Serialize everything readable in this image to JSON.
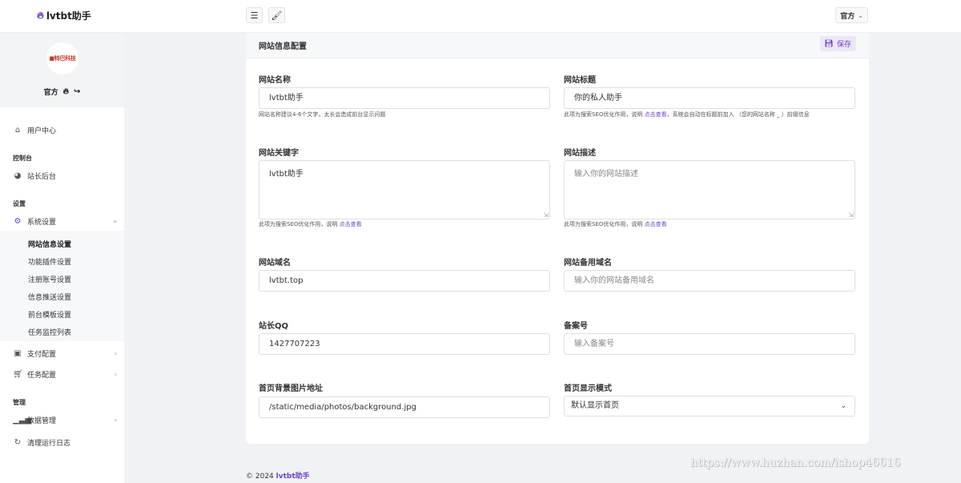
{
  "app": {
    "name": "lvtbt助手"
  },
  "topbar": {
    "menu_icon": "hamburger-icon",
    "theme_icon": "brush-icon",
    "user_label": "官方"
  },
  "sidebar": {
    "profile": {
      "avatar_text": "■特巴科技",
      "name": "官方"
    },
    "user_center": "用户中心",
    "section_console": "控制台",
    "admin_backend": "站长后台",
    "section_settings": "设置",
    "system_settings": "系统设置",
    "sub_items": [
      "网站信息设置",
      "功能插件设置",
      "注册账号设置",
      "信息推送设置",
      "前台模板设置",
      "任务监控列表"
    ],
    "payment_config": "支付配置",
    "task_config": "任务配置",
    "section_manage": "管理",
    "data_manage": "数据管理",
    "clear_logs": "清理运行日志"
  },
  "card": {
    "title": "网站信息配置",
    "save_label": "保存",
    "site_name": {
      "label": "网站名称",
      "value": "lvtbt助手",
      "help": "网站名称建议4-6个文字，太长会造成前台显示问题"
    },
    "site_title": {
      "label": "网站标题",
      "value": "你的私人助手",
      "help_pre": "此项为搜索SEO优化作用，说明",
      "help_link": "点击查看",
      "help_post": "，系统会自动在标题前加入 （您的网站名称 _ ）前缀信息"
    },
    "keywords": {
      "label": "网站关键字",
      "value": "lvtbt助手",
      "help_pre": "此项为搜索SEO优化作用，说明",
      "help_link": "点击查看"
    },
    "description": {
      "label": "网站描述",
      "placeholder": "输入你的网站描述",
      "help_pre": "此项为搜索SEO优化作用，说明",
      "help_link": "点击查看"
    },
    "domain": {
      "label": "网站域名",
      "value": "lvtbt.top"
    },
    "backup_domain": {
      "label": "网站备用域名",
      "placeholder": "输入你的网站备用域名"
    },
    "qq": {
      "label": "站长QQ",
      "value": "1427707223"
    },
    "icp": {
      "label": "备案号",
      "placeholder": "输入备案号"
    },
    "bg_image": {
      "label": "首页背景图片地址",
      "value": "/static/media/photos/background.jpg"
    },
    "display_mode": {
      "label": "首页显示模式",
      "value": "默认显示首页"
    }
  },
  "footer": {
    "copyright": "© 2024",
    "brand": "lvtbt助手"
  },
  "watermark": "https://www.huzhan.com/ishop46616",
  "colors": {
    "accent": "#6f42c1",
    "background": "#f1f2f5"
  }
}
